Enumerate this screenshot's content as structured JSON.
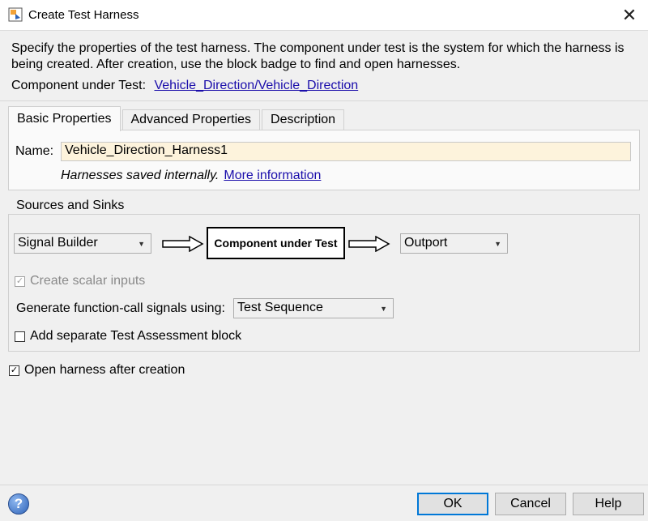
{
  "window": {
    "title": "Create Test Harness",
    "close_icon": "close-icon"
  },
  "description": "Specify the properties of the test harness. The component under test is the system for which the harness is being created. After creation, use the block badge to find and open harnesses.",
  "component_under_test": {
    "label": "Component under Test:",
    "value": "Vehicle_Direction/Vehicle_Direction"
  },
  "tabs": [
    {
      "label": "Basic Properties",
      "active": true
    },
    {
      "label": "Advanced Properties",
      "active": false
    },
    {
      "label": "Description",
      "active": false
    }
  ],
  "basic": {
    "name_label": "Name:",
    "name_value": "Vehicle_Direction_Harness1",
    "note_text": "Harnesses saved internally.",
    "note_link": "More information"
  },
  "sources_sinks": {
    "group_title": "Sources and Sinks",
    "source_selected": "Signal Builder",
    "component_box": "Component under Test",
    "sink_selected": "Outport",
    "create_scalar_inputs": {
      "label": "Create scalar inputs",
      "checked": true,
      "enabled": false
    },
    "function_call_label": "Generate function-call signals using:",
    "function_call_selected": "Test Sequence",
    "add_assessment": {
      "label": "Add separate Test Assessment block",
      "checked": false
    }
  },
  "open_after_creation": {
    "label": "Open harness after creation",
    "checked": true
  },
  "buttons": {
    "ok": "OK",
    "cancel": "Cancel",
    "help": "Help"
  },
  "help_icon_glyph": "?"
}
